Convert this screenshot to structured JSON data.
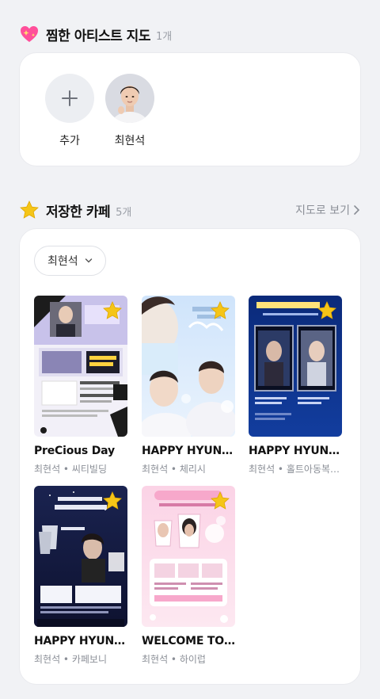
{
  "artists_section": {
    "title": "찜한 아티스트 지도",
    "count": "1개",
    "items": [
      {
        "label": "추가"
      },
      {
        "label": "최현석"
      }
    ]
  },
  "cafes_section": {
    "title": "저장한 카페",
    "count": "5개",
    "map_link": "지도로 보기",
    "filter": "최현석",
    "cafes": [
      {
        "name": "PreCious Day",
        "sub": "최현석 • 씨티빌딩"
      },
      {
        "name": "HAPPY HYUNSUK DAY",
        "sub": "최현석 • 체리시"
      },
      {
        "name": "HAPPY HYUNSUK DAY",
        "sub": "최현석 • 홀트아동복지회"
      },
      {
        "name": "HAPPY HYUNSUK DAY",
        "sub": "최현석 • 카페보니"
      },
      {
        "name": "WELCOME TO WORKPLACE",
        "sub": "최현석 • 하이럽"
      }
    ]
  },
  "colors": {
    "background": "#f1f2f5",
    "star": "#f5c518",
    "muted_text": "#8b8f97"
  }
}
